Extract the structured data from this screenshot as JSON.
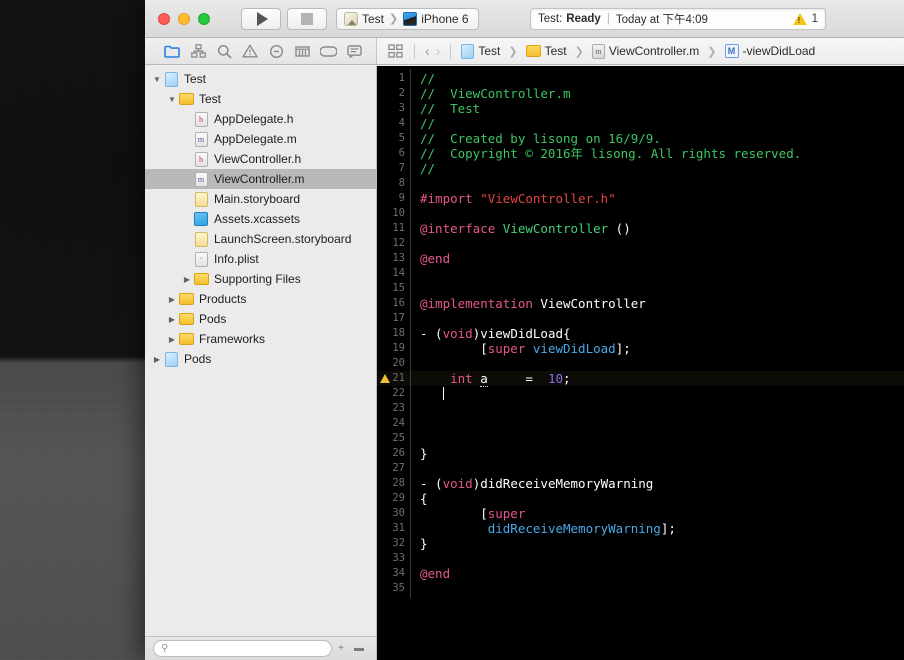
{
  "window": {
    "traffic_lights": [
      "close",
      "minimize",
      "maximize"
    ]
  },
  "toolbar": {
    "run_label": "Run",
    "stop_label": "Stop",
    "scheme_name": "Test",
    "destination_name": "iPhone 6",
    "status_prefix": "Test:",
    "status_state": "Ready",
    "status_separator": "|",
    "status_time": "Today at 下午4:09",
    "warning_count": "1"
  },
  "navigator_toolbar": {
    "icons": [
      {
        "name": "project-navigator-icon",
        "glyph": "folder",
        "active": true
      },
      {
        "name": "symbol-navigator-icon",
        "glyph": "hierarchy",
        "active": false
      },
      {
        "name": "find-navigator-icon",
        "glyph": "search",
        "active": false
      },
      {
        "name": "issue-navigator-icon",
        "glyph": "warning",
        "active": false
      },
      {
        "name": "test-navigator-icon",
        "glyph": "diamond",
        "active": false
      },
      {
        "name": "debug-navigator-icon",
        "glyph": "gauge",
        "active": false
      },
      {
        "name": "breakpoint-navigator-icon",
        "glyph": "tag",
        "active": false
      },
      {
        "name": "report-navigator-icon",
        "glyph": "speech",
        "active": false
      }
    ]
  },
  "jump_bar": {
    "related_items_label": "Related Items",
    "back_arrow": "‹",
    "forward_arrow": "›",
    "breadcrumbs": [
      {
        "label": "Test",
        "icon": "project-icon"
      },
      {
        "label": "Test",
        "icon": "folder-icon"
      },
      {
        "label": "ViewController.m",
        "icon": "objc-file-icon"
      },
      {
        "label": "-viewDidLoad",
        "icon": "method-icon"
      }
    ]
  },
  "navigator": {
    "filter_placeholder": "",
    "tree": [
      {
        "label": "Test",
        "icon": "project-icon",
        "indent": 0,
        "disclosure": "open",
        "selected": false
      },
      {
        "label": "Test",
        "icon": "folder-icon",
        "indent": 1,
        "disclosure": "open",
        "selected": false
      },
      {
        "label": "AppDelegate.h",
        "icon": "header-file-icon",
        "indent": 2,
        "disclosure": "none",
        "selected": false
      },
      {
        "label": "AppDelegate.m",
        "icon": "objc-file-icon",
        "indent": 2,
        "disclosure": "none",
        "selected": false
      },
      {
        "label": "ViewController.h",
        "icon": "header-file-icon",
        "indent": 2,
        "disclosure": "none",
        "selected": false
      },
      {
        "label": "ViewController.m",
        "icon": "objc-file-icon",
        "indent": 2,
        "disclosure": "none",
        "selected": true
      },
      {
        "label": "Main.storyboard",
        "icon": "storyboard-icon",
        "indent": 2,
        "disclosure": "none",
        "selected": false
      },
      {
        "label": "Assets.xcassets",
        "icon": "assets-icon",
        "indent": 2,
        "disclosure": "none",
        "selected": false
      },
      {
        "label": "LaunchScreen.storyboard",
        "icon": "storyboard-icon",
        "indent": 2,
        "disclosure": "none",
        "selected": false
      },
      {
        "label": "Info.plist",
        "icon": "plist-icon",
        "indent": 2,
        "disclosure": "none",
        "selected": false
      },
      {
        "label": "Supporting Files",
        "icon": "folder-icon",
        "indent": 2,
        "disclosure": "closed",
        "selected": false
      },
      {
        "label": "Products",
        "icon": "folder-icon",
        "indent": 1,
        "disclosure": "closed",
        "selected": false
      },
      {
        "label": "Pods",
        "icon": "folder-icon",
        "indent": 1,
        "disclosure": "closed",
        "selected": false
      },
      {
        "label": "Frameworks",
        "icon": "folder-icon",
        "indent": 1,
        "disclosure": "closed",
        "selected": false
      },
      {
        "label": "Pods",
        "icon": "project-icon",
        "indent": 0,
        "disclosure": "closed",
        "selected": false
      }
    ]
  },
  "editor": {
    "language": "objective-c",
    "total_lines": 35,
    "warning_line": 21,
    "caret_line": 22,
    "lines": [
      {
        "n": 1,
        "tokens": [
          {
            "t": "//",
            "c": "comment"
          }
        ]
      },
      {
        "n": 2,
        "tokens": [
          {
            "t": "//  ViewController.m",
            "c": "comment"
          }
        ]
      },
      {
        "n": 3,
        "tokens": [
          {
            "t": "//  Test",
            "c": "comment"
          }
        ]
      },
      {
        "n": 4,
        "tokens": [
          {
            "t": "//",
            "c": "comment"
          }
        ]
      },
      {
        "n": 5,
        "tokens": [
          {
            "t": "//  Created by lisong on 16/9/9.",
            "c": "comment"
          }
        ]
      },
      {
        "n": 6,
        "tokens": [
          {
            "t": "//  Copyright © 2016年 lisong. All rights reserved.",
            "c": "comment"
          }
        ]
      },
      {
        "n": 7,
        "tokens": [
          {
            "t": "//",
            "c": "comment"
          }
        ]
      },
      {
        "n": 8,
        "tokens": []
      },
      {
        "n": 9,
        "tokens": [
          {
            "t": "#import ",
            "c": "pre"
          },
          {
            "t": "\"ViewController.h\"",
            "c": "string"
          }
        ]
      },
      {
        "n": 10,
        "tokens": []
      },
      {
        "n": 11,
        "tokens": [
          {
            "t": "@interface ",
            "c": "kw"
          },
          {
            "t": "ViewController",
            "c": "class"
          },
          {
            "t": " ()",
            "c": "plain"
          }
        ]
      },
      {
        "n": 12,
        "tokens": []
      },
      {
        "n": 13,
        "tokens": [
          {
            "t": "@end",
            "c": "kw"
          }
        ]
      },
      {
        "n": 14,
        "tokens": []
      },
      {
        "n": 15,
        "tokens": []
      },
      {
        "n": 16,
        "tokens": [
          {
            "t": "@implementation ",
            "c": "kw"
          },
          {
            "t": "ViewController",
            "c": "plain"
          }
        ]
      },
      {
        "n": 17,
        "tokens": []
      },
      {
        "n": 18,
        "tokens": [
          {
            "t": "- (",
            "c": "plain"
          },
          {
            "t": "void",
            "c": "kw"
          },
          {
            "t": ")viewDidLoad{",
            "c": "plain"
          }
        ]
      },
      {
        "n": 19,
        "tokens": [
          {
            "t": "        [",
            "c": "plain"
          },
          {
            "t": "super",
            "c": "kw"
          },
          {
            "t": " ",
            "c": "plain"
          },
          {
            "t": "viewDidLoad",
            "c": "method"
          },
          {
            "t": "];",
            "c": "plain"
          }
        ]
      },
      {
        "n": 20,
        "tokens": []
      },
      {
        "n": 21,
        "tokens": [
          {
            "t": "    ",
            "c": "plain"
          },
          {
            "t": "int",
            "c": "kw"
          },
          {
            "t": " ",
            "c": "plain"
          },
          {
            "t": "a",
            "c": "squiggle"
          },
          {
            "t": "     =  ",
            "c": "plain"
          },
          {
            "t": "10",
            "c": "num"
          },
          {
            "t": ";",
            "c": "plain"
          }
        ]
      },
      {
        "n": 22,
        "tokens": []
      },
      {
        "n": 23,
        "tokens": []
      },
      {
        "n": 24,
        "tokens": []
      },
      {
        "n": 25,
        "tokens": []
      },
      {
        "n": 26,
        "tokens": [
          {
            "t": "}",
            "c": "plain"
          }
        ]
      },
      {
        "n": 27,
        "tokens": []
      },
      {
        "n": 28,
        "tokens": [
          {
            "t": "- (",
            "c": "plain"
          },
          {
            "t": "void",
            "c": "kw"
          },
          {
            "t": ")didReceiveMemoryWarning",
            "c": "plain"
          }
        ]
      },
      {
        "n": 29,
        "tokens": [
          {
            "t": "{",
            "c": "plain"
          }
        ]
      },
      {
        "n": 30,
        "tokens": [
          {
            "t": "        [",
            "c": "plain"
          },
          {
            "t": "super",
            "c": "kw"
          }
        ]
      },
      {
        "n": 31,
        "tokens": [
          {
            "t": "         ",
            "c": "plain"
          },
          {
            "t": "didReceiveMemoryWarning",
            "c": "method"
          },
          {
            "t": "];",
            "c": "plain"
          }
        ]
      },
      {
        "n": 32,
        "tokens": [
          {
            "t": "}",
            "c": "plain"
          }
        ]
      },
      {
        "n": 33,
        "tokens": []
      },
      {
        "n": 34,
        "tokens": [
          {
            "t": "@end",
            "c": "kw"
          }
        ]
      },
      {
        "n": 35,
        "tokens": []
      }
    ]
  },
  "colors": {
    "editor_background": "#000000",
    "comment": "#3fc464",
    "keyword": "#e6568f",
    "string": "#e2463f",
    "class_name": "#44d07a",
    "method": "#4aa8e8",
    "number": "#8b6cf0",
    "plain_text": "#ffffff",
    "warning": "#f2c033",
    "accent": "#2a7fe0",
    "selection": "#b9b9b9"
  }
}
